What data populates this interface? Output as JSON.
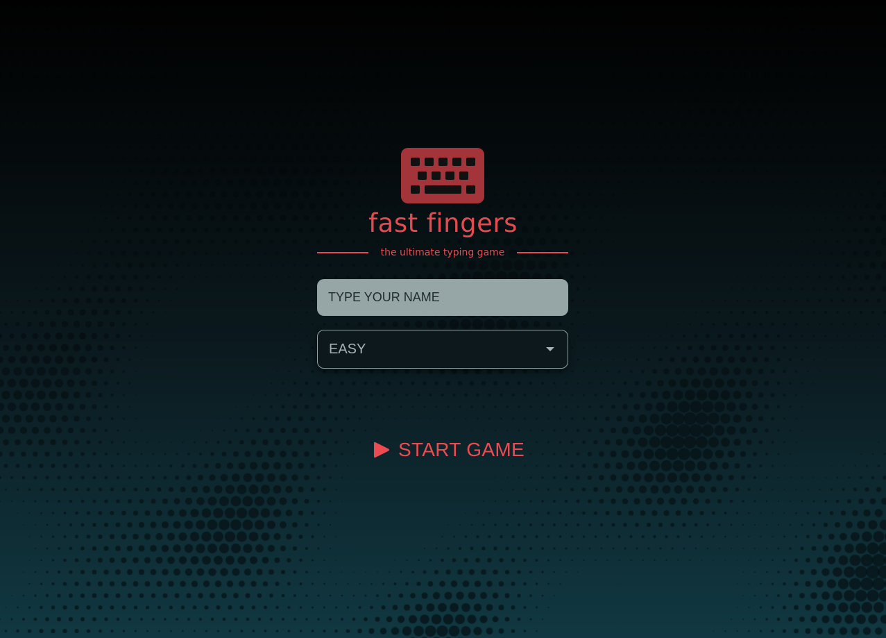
{
  "app": {
    "title": "fast fingers",
    "tagline": "the ultimate typing game",
    "logo_icon": "keyboard-icon"
  },
  "form": {
    "name_placeholder": "TYPE YOUR NAME",
    "name_value": "",
    "difficulty_selected": "EASY"
  },
  "actions": {
    "start_label": "START GAME",
    "start_icon": "play-icon"
  },
  "colors": {
    "accent": "#e24c51",
    "logo_fill": "#a3343a",
    "input_bg": "#96a6a6",
    "select_bg": "#0c181c",
    "background_top": "#010101",
    "background_bottom": "#113842"
  }
}
